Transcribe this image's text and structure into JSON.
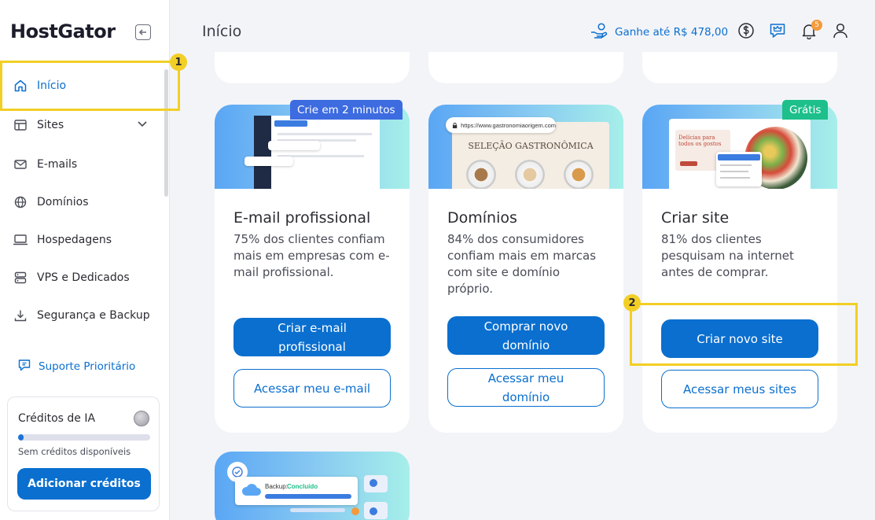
{
  "brand": {
    "logo": "HostGator"
  },
  "sidebar": {
    "items": [
      {
        "label": "Início",
        "icon": "home-icon",
        "active": true
      },
      {
        "label": "Sites",
        "icon": "sites-icon"
      },
      {
        "label": "E-mails",
        "icon": "mail-icon"
      },
      {
        "label": "Domínios",
        "icon": "globe-icon"
      },
      {
        "label": "Hospedagens",
        "icon": "laptop-icon"
      },
      {
        "label": "VPS e Dedicados",
        "icon": "server-icon"
      },
      {
        "label": "Segurança e Backup",
        "icon": "download-icon"
      }
    ],
    "support": "Suporte Prioritário",
    "credits": {
      "title": "Créditos de IA",
      "progress": 0.04,
      "status": "Sem créditos disponíveis",
      "button": "Adicionar créditos"
    }
  },
  "header": {
    "title": "Início",
    "earn": "Ganhe até R$ 478,00",
    "notifications": "5"
  },
  "annotations": {
    "step1": "1",
    "step2": "2"
  },
  "cards": {
    "email": {
      "tag": "Crie em 2 minutos",
      "title": "E-mail profissional",
      "desc": "75% dos clientes confiam mais em empresas com e-mail profissional.",
      "primary": "Criar e-mail profissional",
      "secondary": "Acessar meu e-mail"
    },
    "domains": {
      "url": "https://www.gastronomiaorigem.com",
      "banner": "SELEÇÃO GASTRONÔMICA",
      "title": "Domínios",
      "desc": "84% dos consumidores confiam mais em marcas com site e domínio próprio.",
      "primary": "Comprar novo domínio",
      "secondary": "Acessar meu domínio"
    },
    "site": {
      "tag": "Grátis",
      "mock_heading": "Delícias para todos os gostos",
      "title": "Criar site",
      "desc": "81% dos clientes pesquisam na internet antes de comprar.",
      "primary": "Criar novo site",
      "secondary": "Acessar meus sites"
    },
    "backup": {
      "label": "Backup:",
      "status": "Concluído"
    }
  },
  "colors": {
    "accent": "#0a6fcf",
    "highlight": "#f2cf25",
    "tag_blue": "#3d6be0",
    "tag_green": "#1dbf8a"
  }
}
